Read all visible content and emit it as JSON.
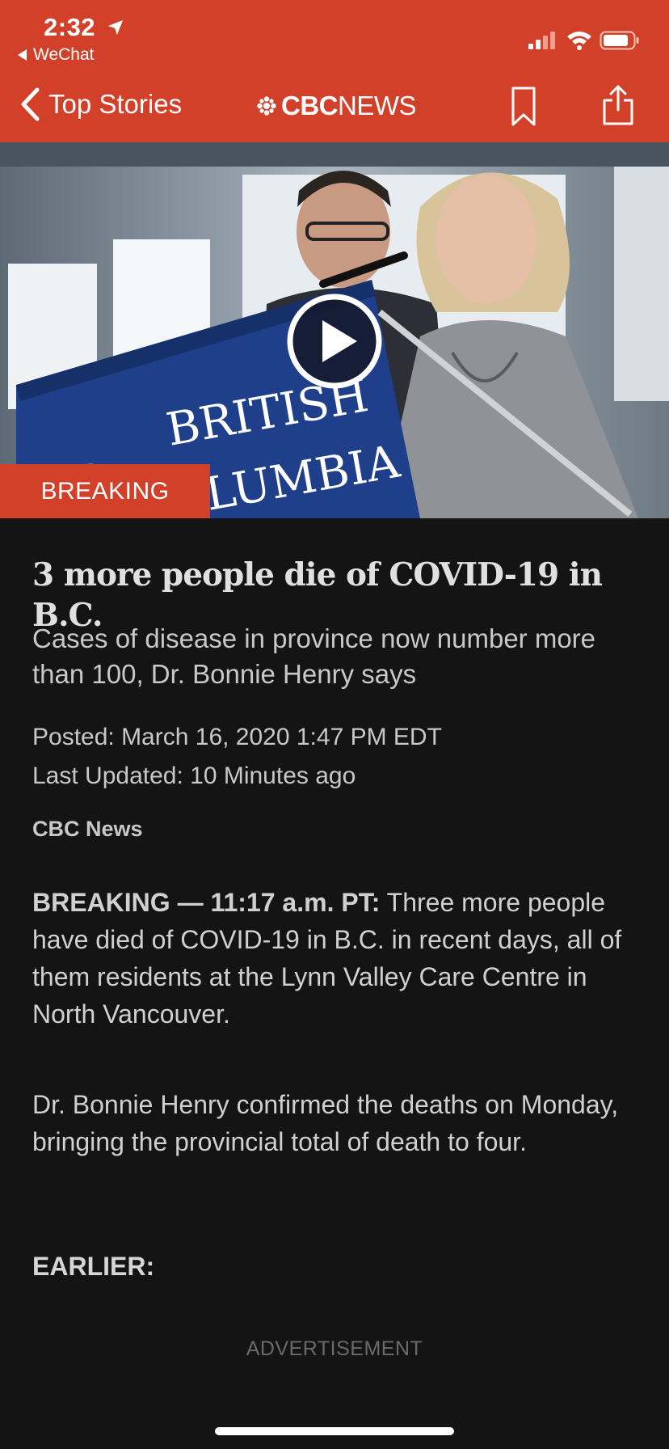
{
  "status_bar": {
    "time": "2:32",
    "back_app": "WeChat",
    "icons": [
      "location-arrow-icon",
      "signal-icon",
      "wifi-icon",
      "battery-icon"
    ]
  },
  "nav": {
    "back_label": "Top Stories",
    "brand_cbc": "CBC",
    "brand_news": "NEWS",
    "actions": [
      "bookmark-icon",
      "share-icon"
    ]
  },
  "hero": {
    "podium_line1": "BRITISH",
    "podium_line2": "LUMBIA",
    "tag": "BREAKING",
    "media_control": "play-icon"
  },
  "article": {
    "headline": "3 more people die of COVID-19 in B.C.",
    "dek": "Cases of disease in province now number more than 100, Dr. Bonnie Henry says",
    "posted": "Posted: March 16, 2020 1:47 PM EDT",
    "updated": "Last Updated: 10 Minutes ago",
    "source": "CBC News",
    "p1_lead": "BREAKING — 11:17 a.m. PT:",
    "p1_body": " Three more people have died of COVID-19 in B.C. in recent days, all of them residents at the Lynn Valley Care Centre in North Vancouver.",
    "p2": "Dr. Bonnie Henry confirmed the deaths on Monday, bringing the provincial total of death to four.",
    "earlier": "EARLIER:",
    "advertisement": "ADVERTISEMENT"
  },
  "colors": {
    "brand_red": "#d3402a",
    "background": "#141414",
    "text": "#d0d0d0"
  }
}
